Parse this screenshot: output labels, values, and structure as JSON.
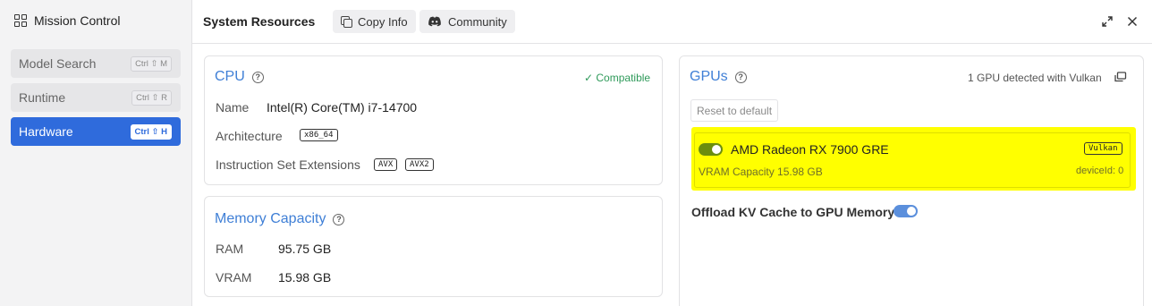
{
  "sidebar": {
    "title": "Mission Control",
    "items": [
      {
        "label": "Model Search",
        "shortcut": "Ctrl ⇧ M",
        "active": false
      },
      {
        "label": "Runtime",
        "shortcut": "Ctrl ⇧ R",
        "active": false
      },
      {
        "label": "Hardware",
        "shortcut": "Ctrl ⇧ H",
        "active": true
      }
    ]
  },
  "header": {
    "title": "System Resources",
    "copy_label": "Copy Info",
    "community_label": "Community"
  },
  "cpu": {
    "title": "CPU",
    "status": "✓ Compatible",
    "name_label": "Name",
    "name_value": "Intel(R) Core(TM) i7-14700",
    "arch_label": "Architecture",
    "arch_value": "x86_64",
    "isa_label": "Instruction Set Extensions",
    "isa_values": [
      "AVX",
      "AVX2"
    ]
  },
  "memory": {
    "title": "Memory Capacity",
    "ram_label": "RAM",
    "ram_value": "95.75 GB",
    "vram_label": "VRAM",
    "vram_value": "15.98 GB"
  },
  "gpus": {
    "title": "GPUs",
    "detected": "1 GPU detected with Vulkan",
    "reset_label": "Reset to default",
    "items": [
      {
        "name": "AMD Radeon RX 7900 GRE",
        "backend": "Vulkan",
        "vram": "VRAM Capacity 15.98 GB",
        "device": "deviceId: 0",
        "enabled": true
      }
    ],
    "offload_label": "Offload KV Cache to GPU Memory",
    "offload_enabled": true
  },
  "colors": {
    "accent": "#2f6bdc",
    "section_title": "#3f7fd6",
    "highlight": "#ffff00",
    "gpu_toggle": "#6b8e0e",
    "offload_toggle": "#5b8fdc",
    "compatible": "#2f9a5a"
  }
}
